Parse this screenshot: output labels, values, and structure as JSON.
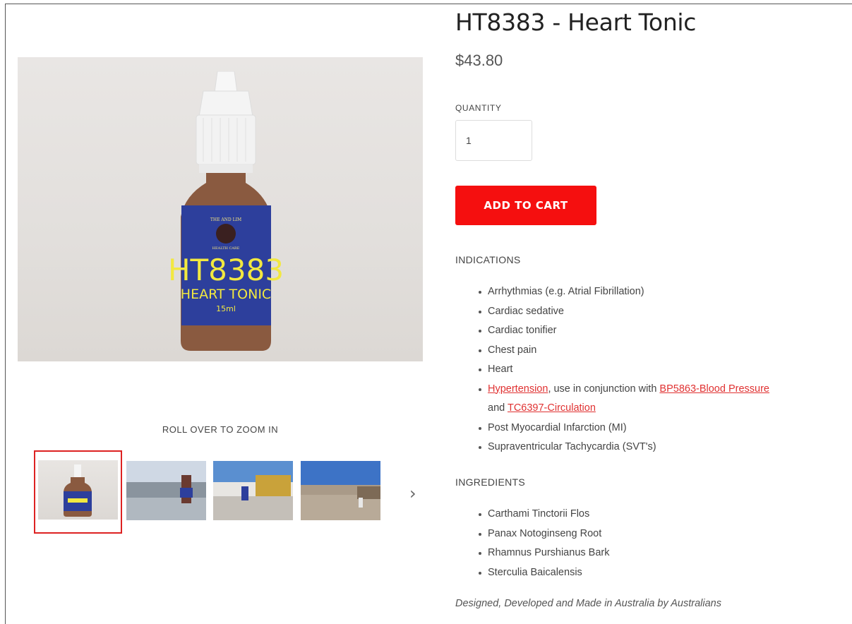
{
  "product": {
    "title": "HT8383 - Heart Tonic",
    "price": "$43.80",
    "quantity_label": "QUANTITY",
    "quantity_value": "1",
    "add_to_cart": "ADD TO CART"
  },
  "gallery": {
    "zoom_hint": "ROLL OVER TO ZOOM IN",
    "bottle_label": {
      "brand_top": "THE AND LIM",
      "code": "HT8383",
      "name": "HEART TONIC",
      "volume": "15ml",
      "brand_bottom": "HEALTH CARE"
    }
  },
  "indications": {
    "heading": "INDICATIONS",
    "items": [
      "Arrhythmias (e.g. Atrial Fibrillation)",
      "Cardiac sedative",
      "Cardiac tonifier",
      "Chest pain",
      "Heart"
    ],
    "linked_item": {
      "link1": "Hypertension",
      "text1": ", use in conjunction with ",
      "link2": "BP5863-Blood Pressure",
      "text2": "and ",
      "link3": "TC6397-Circulation"
    },
    "items_after": [
      "Post Myocardial Infarction (MI)",
      "Supraventricular Tachycardia (SVT's)"
    ]
  },
  "ingredients": {
    "heading": "INGREDIENTS",
    "items": [
      "Carthami Tinctorii Flos",
      "Panax Notoginseng Root",
      "Rhamnus Purshianus Bark",
      "Sterculia Baicalensis"
    ]
  },
  "footer_note": "Designed, Developed and Made in Australia by Australians",
  "colors": {
    "accent": "#f50f0f",
    "link": "#e03131",
    "thumb_border": "#dd2222"
  },
  "icons": {
    "next": "chevron-right-icon"
  }
}
